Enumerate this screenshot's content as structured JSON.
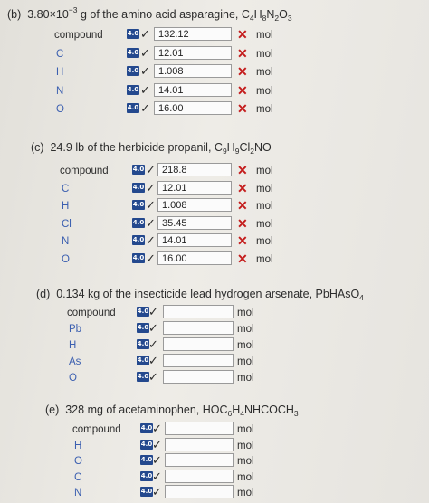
{
  "sections": {
    "b": {
      "letter": "(b)",
      "title_pre": "3.80×10",
      "title_exp": "−3",
      "title_mid": "g of the amino acid asparagine, C",
      "title_formula": "4H8N2O3",
      "rows": [
        {
          "label": "compound",
          "value": "132.12"
        },
        {
          "label": "C",
          "value": "12.01"
        },
        {
          "label": "H",
          "value": "1.008"
        },
        {
          "label": "N",
          "value": "14.01"
        },
        {
          "label": "O",
          "value": "16.00"
        }
      ]
    },
    "c": {
      "letter": "(c)",
      "title": "24.9 lb of the herbicide propanil, C9H9Cl2NO",
      "rows": [
        {
          "label": "compound",
          "value": "218.8"
        },
        {
          "label": "C",
          "value": "12.01"
        },
        {
          "label": "H",
          "value": "1.008"
        },
        {
          "label": "Cl",
          "value": "35.45"
        },
        {
          "label": "N",
          "value": "14.01"
        },
        {
          "label": "O",
          "value": "16.00"
        }
      ]
    },
    "d": {
      "letter": "(d)",
      "title": "0.134 kg of the insecticide lead hydrogen arsenate, PbHAsO4",
      "rows": [
        {
          "label": "compound",
          "value": ""
        },
        {
          "label": "Pb",
          "value": ""
        },
        {
          "label": "H",
          "value": ""
        },
        {
          "label": "As",
          "value": ""
        },
        {
          "label": "O",
          "value": ""
        }
      ]
    },
    "e": {
      "letter": "(e)",
      "title": "328 mg of acetaminophen, HOC6H4NHCOCH3",
      "rows": [
        {
          "label": "compound",
          "value": ""
        },
        {
          "label": "H",
          "value": ""
        },
        {
          "label": "O",
          "value": ""
        },
        {
          "label": "C",
          "value": ""
        },
        {
          "label": "N",
          "value": ""
        }
      ]
    }
  },
  "badge_text": "4.0",
  "unit_label": "mol",
  "check_glyph": "✓",
  "wrong_glyph": "✕",
  "colors": {
    "badge": "#24498e",
    "wrong": "#c41c1c",
    "element_label": "#3b5fb0"
  }
}
